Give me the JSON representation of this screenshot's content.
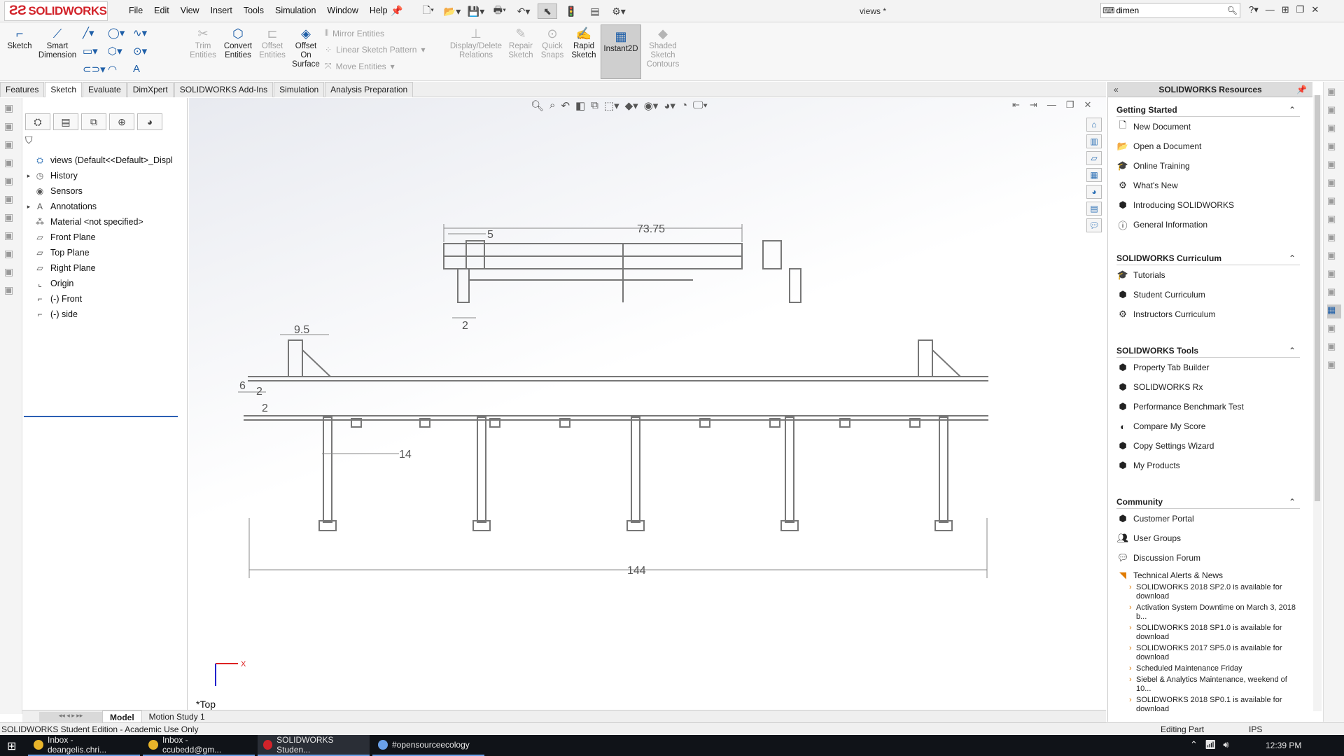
{
  "app": {
    "brand": "SOLIDWORKS",
    "doc_title": "views *"
  },
  "menu": [
    "File",
    "Edit",
    "View",
    "Insert",
    "Tools",
    "Simulation",
    "Window",
    "Help"
  ],
  "search": {
    "value": "dimen"
  },
  "ribbon": {
    "sketch": "Sketch",
    "smart_dimension": "Smart Dimension",
    "trim_entities": "Trim Entities",
    "convert_entities": "Convert Entities",
    "offset_entities": "Offset Entities",
    "offset_on_surface": "Offset On Surface",
    "mirror_entities": "Mirror Entities",
    "linear_sketch_pattern": "Linear Sketch Pattern",
    "move_entities": "Move Entities",
    "display_delete_relations": "Display/Delete Relations",
    "repair_sketch": "Repair Sketch",
    "quick_snaps": "Quick Snaps",
    "rapid_sketch": "Rapid Sketch",
    "instant2d": "Instant2D",
    "shaded_sketch_contours": "Shaded Sketch Contours"
  },
  "tabs": [
    "Features",
    "Sketch",
    "Evaluate",
    "DimXpert",
    "SOLIDWORKS Add-Ins",
    "Simulation",
    "Analysis Preparation"
  ],
  "tree": {
    "root": "views  (Default<<Default>_Displ",
    "items": [
      "History",
      "Sensors",
      "Annotations",
      "Material <not specified>",
      "Front Plane",
      "Top Plane",
      "Right Plane",
      "Origin",
      "(-) Front",
      "(-) side"
    ]
  },
  "viewport": {
    "view_label": "*Top",
    "triad_x": "X",
    "dims": {
      "d1": "73.75",
      "d2": "5",
      "d3": "2",
      "d4": "9.5",
      "d5": "6",
      "d6": "2",
      "d7": "2",
      "d8": "14",
      "d9": "144"
    }
  },
  "bottom_tabs": [
    "Model",
    "Motion Study 1"
  ],
  "status": {
    "left": "SOLIDWORKS Student Edition - Academic Use Only",
    "mode": "Editing Part",
    "units": "IPS"
  },
  "taskpane": {
    "title": "SOLIDWORKS Resources",
    "getting_started": {
      "title": "Getting Started",
      "items": [
        "New Document",
        "Open a Document",
        "Online Training",
        "What's New",
        "Introducing SOLIDWORKS",
        "General Information"
      ]
    },
    "curriculum": {
      "title": "SOLIDWORKS Curriculum",
      "items": [
        "Tutorials",
        "Student Curriculum",
        "Instructors Curriculum"
      ]
    },
    "tools": {
      "title": "SOLIDWORKS Tools",
      "items": [
        "Property Tab Builder",
        "SOLIDWORKS Rx",
        "Performance Benchmark Test",
        "Compare My Score",
        "Copy Settings Wizard",
        "My Products"
      ]
    },
    "community": {
      "title": "Community",
      "items": [
        "Customer Portal",
        "User Groups",
        "Discussion Forum",
        "Technical Alerts & News"
      ]
    },
    "news": [
      "SOLIDWORKS 2018 SP2.0 is available for download",
      "Activation System Downtime on March 3, 2018 b...",
      "SOLIDWORKS 2018 SP1.0 is available for download",
      "SOLIDWORKS 2017 SP5.0 is available for download",
      "Scheduled Maintenance Friday",
      "Siebel & Analytics Maintenance, weekend of 10...",
      "SOLIDWORKS 2018 SP0.1 is available for download"
    ]
  },
  "taskbar": {
    "tasks": [
      "Inbox - deangelis.chri...",
      "Inbox - ccubedd@gm...",
      "SOLIDWORKS Studen...",
      "#opensourceecology"
    ],
    "clock": "12:39 PM"
  },
  "colors": {
    "accent": "#d2232a",
    "blue": "#1f5fa8",
    "sketch": "#7a7a7a"
  }
}
